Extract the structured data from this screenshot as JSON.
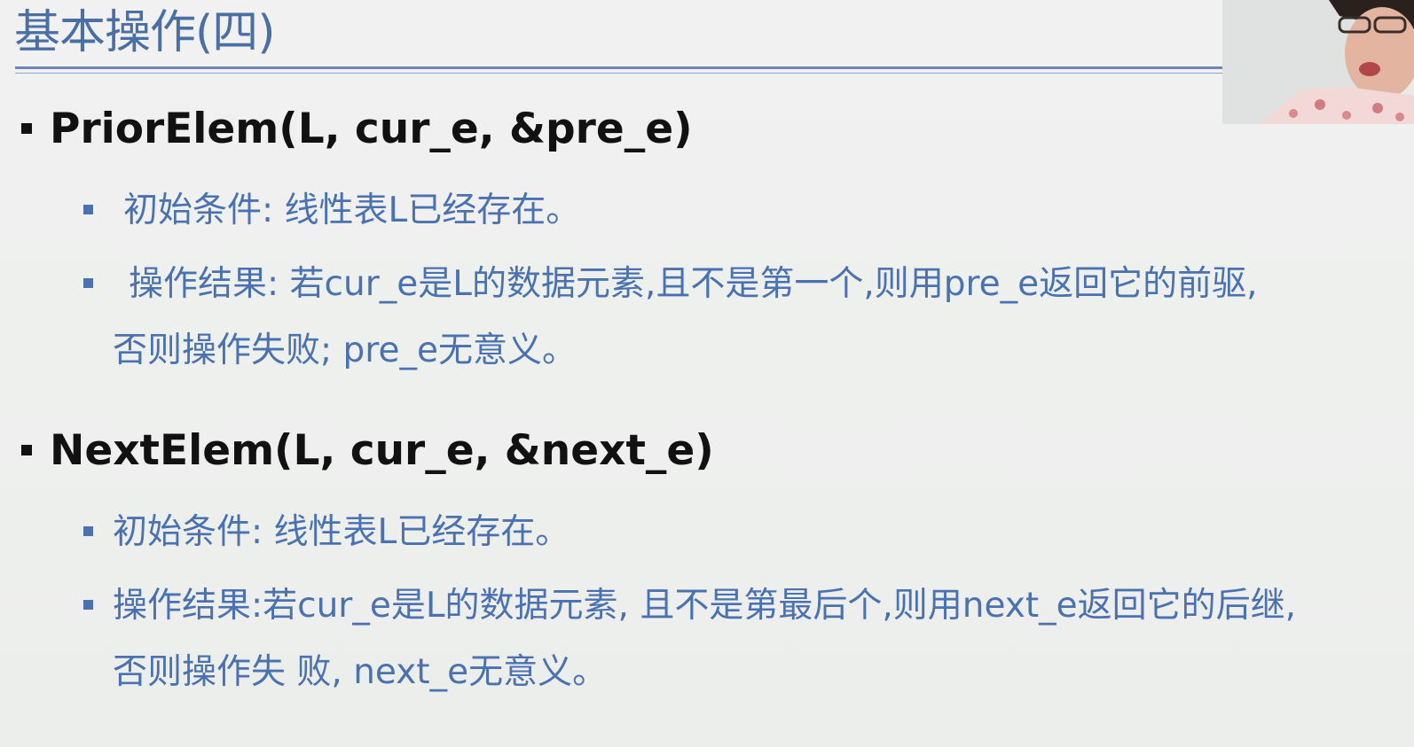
{
  "slide": {
    "title": "基本操作(四)",
    "sections": [
      {
        "heading": "PriorElem(L, cur_e, &pre_e)",
        "items": [
          {
            "text": "初始条件: 线性表L已经存在。"
          },
          {
            "text": "操作结果: 若cur_e是L的数据元素,且不是第一个,则用pre_e返回它的前驱,",
            "continuation": "否则操作失败; pre_e无意义。"
          }
        ]
      },
      {
        "heading": "NextElem(L, cur_e, &next_e)",
        "items": [
          {
            "text": "初始条件: 线性表L已经存在。"
          },
          {
            "text": "操作结果:若cur_e是L的数据元素, 且不是第最后个,则用next_e返回它的后继,",
            "continuation": "否则操作失 败, next_e无意义。"
          }
        ]
      }
    ]
  },
  "colors": {
    "title": "#4a6fa5",
    "heading": "#111111",
    "body_text": "#4a72b0",
    "background": "#eef0ee"
  }
}
